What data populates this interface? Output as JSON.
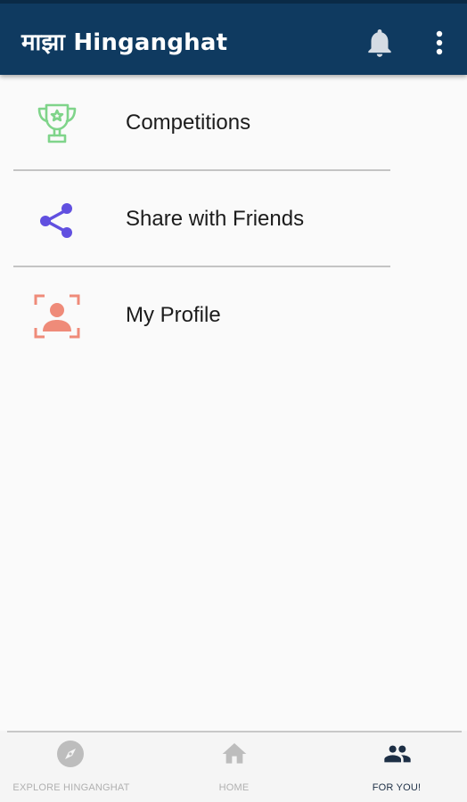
{
  "app_bar": {
    "title": "माझा Hinganghat",
    "background_color": "#0f3a60",
    "actions": [
      {
        "icon": "bell-icon"
      },
      {
        "icon": "more-vert-icon"
      }
    ]
  },
  "menu": {
    "items": [
      {
        "label": "Competitions",
        "icon": "trophy-icon",
        "icon_color": "#7fd48a"
      },
      {
        "label": "Share with Friends",
        "icon": "share-icon",
        "icon_color": "#6150e0"
      },
      {
        "label": "My Profile",
        "icon": "profile-icon",
        "icon_color": "#ef8b79"
      }
    ]
  },
  "bottom_nav": {
    "items": [
      {
        "label": "EXPLORE HINGANGHAT",
        "icon": "compass-icon",
        "active": false
      },
      {
        "label": "HOME",
        "icon": "home-icon",
        "active": false
      },
      {
        "label": "FOR YOU!",
        "icon": "people-icon",
        "active": true
      }
    ],
    "active_color": "#1d2f45",
    "inactive_color": "#b0b0b0"
  }
}
